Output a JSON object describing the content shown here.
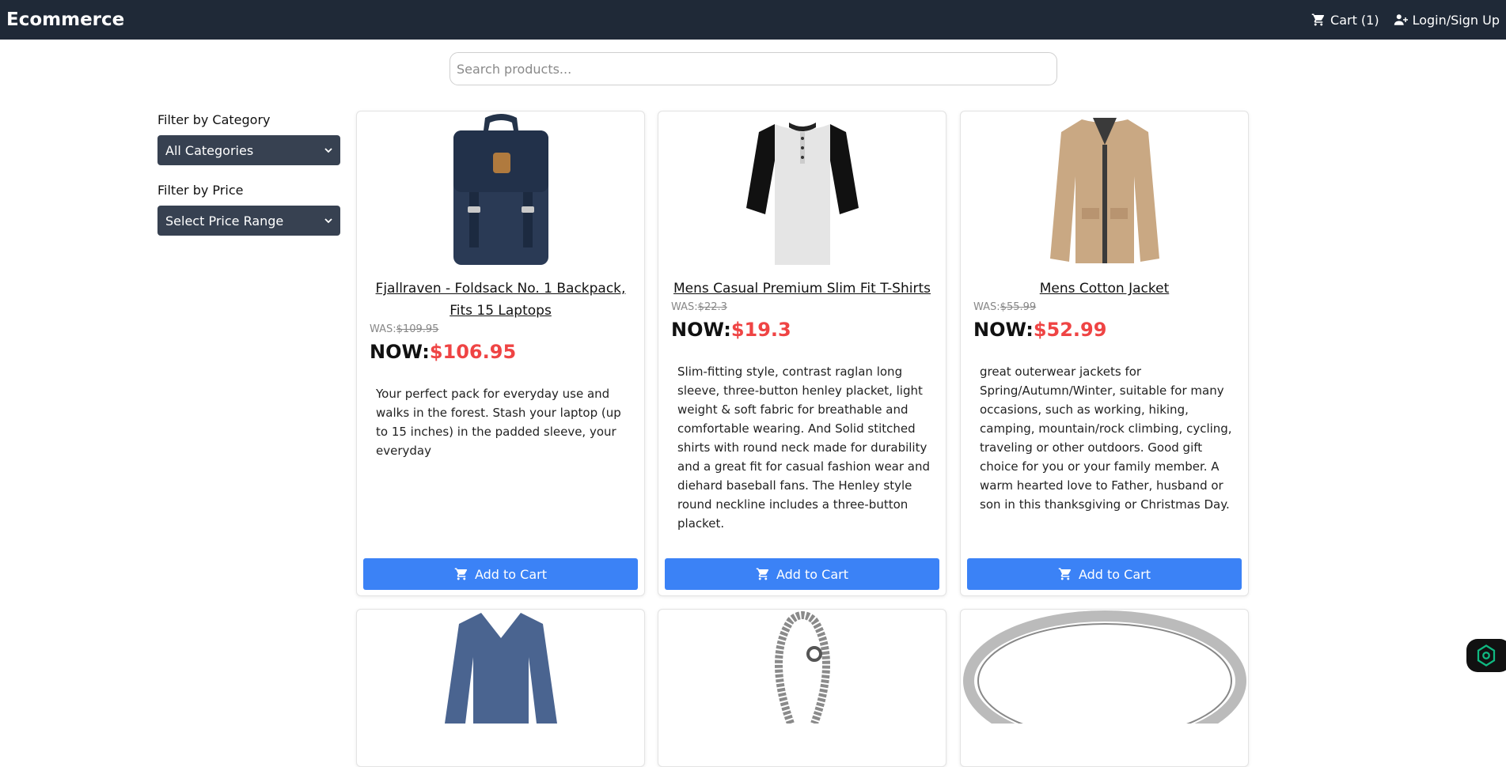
{
  "navbar": {
    "brand": "Ecommerce",
    "cart_label": "Cart (1)",
    "login_label": "Login/Sign Up"
  },
  "search": {
    "placeholder": "Search products..."
  },
  "sidebar": {
    "category_label": "Filter by Category",
    "category_selected": "All Categories",
    "price_label": "Filter by Price",
    "price_selected": "Select Price Range"
  },
  "products": [
    {
      "title": "Fjallraven - Foldsack No. 1 Backpack, Fits 15 Laptops",
      "was_label": "WAS:",
      "was_price": "$109.95",
      "now_label": "NOW:",
      "now_price": "$106.95",
      "description": "Your perfect pack for everyday use and walks in the forest. Stash your laptop (up to 15 inches) in the padded sleeve, your everyday",
      "button": "Add to Cart"
    },
    {
      "title": "Mens Casual Premium Slim Fit T-Shirts",
      "was_label": "WAS:",
      "was_price": "$22.3",
      "now_label": "NOW:",
      "now_price": "$19.3",
      "description": "Slim-fitting style, contrast raglan long sleeve, three-button henley placket, light weight & soft fabric for breathable and comfortable wearing. And Solid stitched shirts with round neck made for durability and a great fit for casual fashion wear and diehard baseball fans. The Henley style round neckline includes a three-button placket.",
      "button": "Add to Cart"
    },
    {
      "title": "Mens Cotton Jacket",
      "was_label": "WAS:",
      "was_price": "$55.99",
      "now_label": "NOW:",
      "now_price": "$52.99",
      "description": "great outerwear jackets for Spring/Autumn/Winter, suitable for many occasions, such as working, hiking, camping, mountain/rock climbing, cycling, traveling or other outdoors. Good gift choice for you or your family member. A warm hearted love to Father, husband or son in this thanksgiving or Christmas Day.",
      "button": "Add to Cart"
    }
  ],
  "colors": {
    "navbar": "#1f2937",
    "button": "#3b82f6",
    "price": "#ef4444",
    "select": "#374151"
  }
}
